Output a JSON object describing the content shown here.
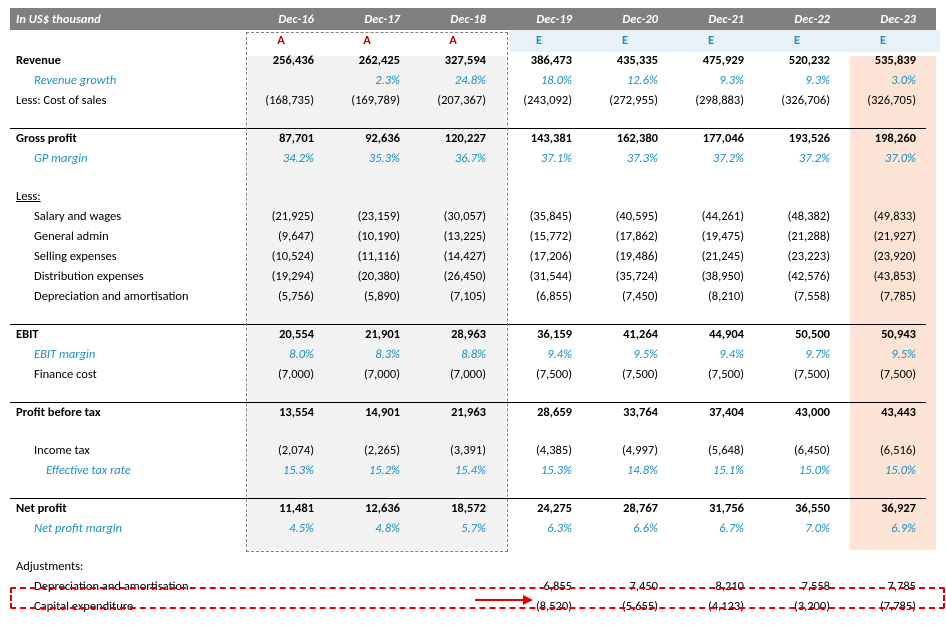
{
  "header": {
    "label": "In US$ thousand"
  },
  "columns": {
    "headers": [
      "Dec-16",
      "Dec-17",
      "Dec-18",
      "Dec-19",
      "Dec-20",
      "Dec-21",
      "Dec-22",
      "Dec-23"
    ],
    "types": [
      "A",
      "A",
      "A",
      "E",
      "E",
      "E",
      "E",
      "E"
    ]
  },
  "chart_data": {
    "type": "table",
    "title": "In US$ thousand",
    "rows": [
      {
        "label": "Revenue",
        "style": "bold",
        "v": [
          "256,436",
          "262,425",
          "327,594",
          "386,473",
          "435,335",
          "475,929",
          "520,232",
          "535,839"
        ]
      },
      {
        "label": "Revenue growth",
        "style": "metric indent1",
        "v": [
          "",
          "2.3%",
          "24.8%",
          "18.0%",
          "12.6%",
          "9.3%",
          "9.3%",
          "3.0%"
        ]
      },
      {
        "label": "Less: Cost of sales",
        "v": [
          "(168,735)",
          "(169,789)",
          "(207,367)",
          "(243,092)",
          "(272,955)",
          "(298,883)",
          "(326,706)",
          "(326,705)"
        ]
      },
      {
        "blank": true
      },
      {
        "label": "Gross profit",
        "style": "bold top-line",
        "v": [
          "87,701",
          "92,636",
          "120,227",
          "143,381",
          "162,380",
          "177,046",
          "193,526",
          "198,260"
        ]
      },
      {
        "label": "GP margin",
        "style": "metric indent1",
        "v": [
          "34.2%",
          "35.3%",
          "36.7%",
          "37.1%",
          "37.3%",
          "37.2%",
          "37.2%",
          "37.0%"
        ]
      },
      {
        "blank": true
      },
      {
        "label": "Less:",
        "style": "ul"
      },
      {
        "label": "Salary and wages",
        "style": "indent1",
        "v": [
          "(21,925)",
          "(23,159)",
          "(30,057)",
          "(35,845)",
          "(40,595)",
          "(44,261)",
          "(48,382)",
          "(49,833)"
        ]
      },
      {
        "label": "General admin",
        "style": "indent1",
        "v": [
          "(9,647)",
          "(10,190)",
          "(13,225)",
          "(15,772)",
          "(17,862)",
          "(19,475)",
          "(21,288)",
          "(21,927)"
        ]
      },
      {
        "label": "Selling expenses",
        "style": "indent1",
        "v": [
          "(10,524)",
          "(11,116)",
          "(14,427)",
          "(17,206)",
          "(19,486)",
          "(21,245)",
          "(23,223)",
          "(23,920)"
        ]
      },
      {
        "label": "Distribution expenses",
        "style": "indent1",
        "v": [
          "(19,294)",
          "(20,380)",
          "(26,450)",
          "(31,544)",
          "(35,724)",
          "(38,950)",
          "(42,576)",
          "(43,853)"
        ]
      },
      {
        "label": "Depreciation and amortisation",
        "style": "indent1",
        "v": [
          "(5,756)",
          "(5,890)",
          "(7,105)",
          "(6,855)",
          "(7,450)",
          "(8,210)",
          "(7,558)",
          "(7,785)"
        ]
      },
      {
        "blank": true
      },
      {
        "label": "EBIT",
        "style": "bold top-line",
        "v": [
          "20,554",
          "21,901",
          "28,963",
          "36,159",
          "41,264",
          "44,904",
          "50,500",
          "50,943"
        ]
      },
      {
        "label": "EBIT margin",
        "style": "metric indent1",
        "v": [
          "8.0%",
          "8.3%",
          "8.8%",
          "9.4%",
          "9.5%",
          "9.4%",
          "9.7%",
          "9.5%"
        ]
      },
      {
        "label": "Finance cost",
        "style": "indent1",
        "v": [
          "(7,000)",
          "(7,000)",
          "(7,000)",
          "(7,500)",
          "(7,500)",
          "(7,500)",
          "(7,500)",
          "(7,500)"
        ]
      },
      {
        "blank": true
      },
      {
        "label": "Profit before tax",
        "style": "bold top-line",
        "v": [
          "13,554",
          "14,901",
          "21,963",
          "28,659",
          "33,764",
          "37,404",
          "43,000",
          "43,443"
        ]
      },
      {
        "blank": true
      },
      {
        "label": "Income tax",
        "style": "indent1",
        "v": [
          "(2,074)",
          "(2,265)",
          "(3,391)",
          "(4,385)",
          "(4,997)",
          "(5,648)",
          "(6,450)",
          "(6,516)"
        ]
      },
      {
        "label": "Effective tax rate",
        "style": "metric indent2",
        "v": [
          "15.3%",
          "15.2%",
          "15.4%",
          "15.3%",
          "14.8%",
          "15.1%",
          "15.0%",
          "15.0%"
        ]
      },
      {
        "blank": true
      },
      {
        "label": "Net profit",
        "style": "bold top-line",
        "v": [
          "11,481",
          "12,636",
          "18,572",
          "24,275",
          "28,767",
          "31,756",
          "36,550",
          "36,927"
        ]
      },
      {
        "label": "Net profit margin",
        "style": "metric indent1",
        "v": [
          "4.5%",
          "4.8%",
          "5.7%",
          "6.3%",
          "6.6%",
          "6.7%",
          "7.0%",
          "6.9%"
        ]
      },
      {
        "blank": true
      },
      {
        "label": "Adjustments:"
      },
      {
        "label": "Depreciation and amortisation",
        "style": "indent1",
        "v": [
          "",
          "",
          "",
          "6,855",
          "7,450",
          "8,210",
          "7,558",
          "7,785"
        ]
      },
      {
        "label": "Capital expenditure",
        "style": "indent1",
        "v": [
          "",
          "",
          "",
          "(8,520)",
          "(5,655)",
          "(4,123)",
          "(3,200)",
          "(7,785)"
        ]
      }
    ]
  }
}
